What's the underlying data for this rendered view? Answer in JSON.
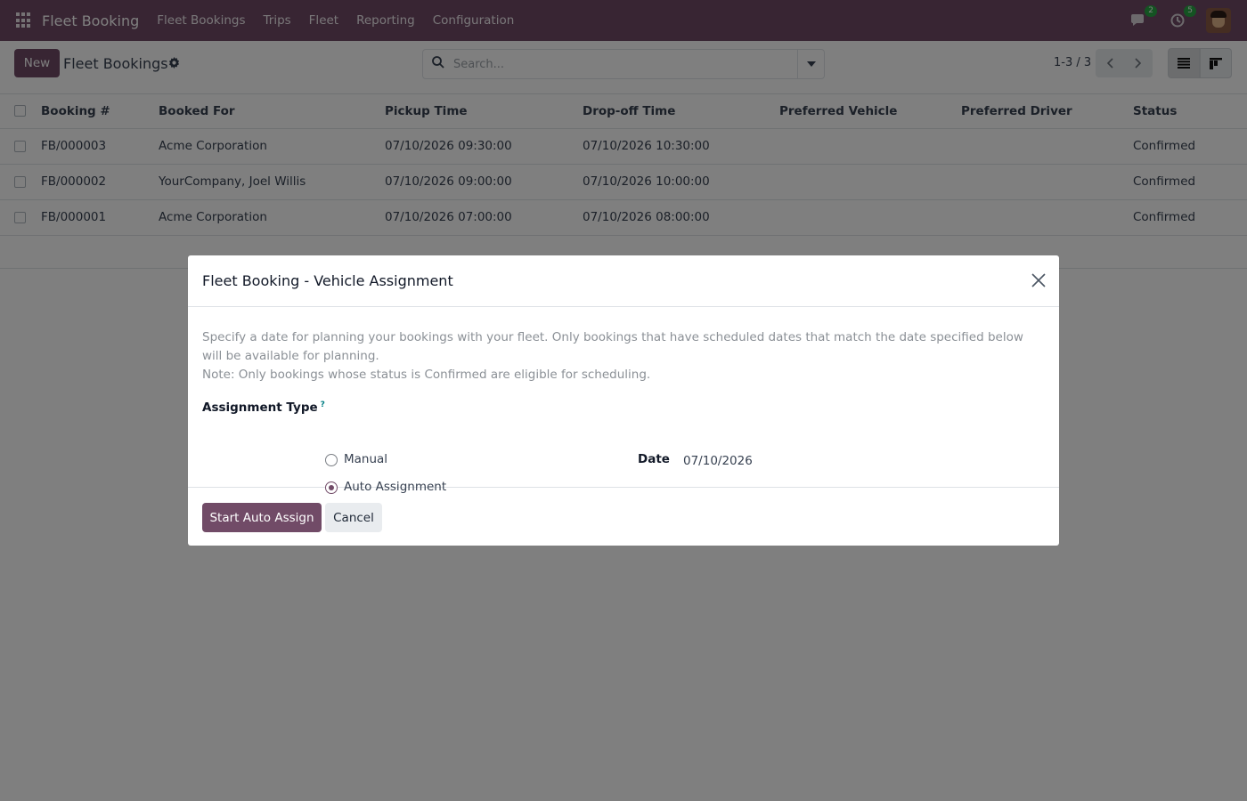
{
  "navbar": {
    "brand": "Fleet Booking",
    "menu": [
      "Fleet Bookings",
      "Trips",
      "Fleet",
      "Reporting",
      "Configuration"
    ],
    "messages_count": "2",
    "activities_count": "5",
    "accent_color": "#714B67"
  },
  "control_panel": {
    "new_label": "New",
    "title": "Fleet Bookings",
    "search_placeholder": "Search...",
    "pager": "1-3 / 3"
  },
  "table": {
    "columns": [
      "Booking #",
      "Booked For",
      "Pickup Time",
      "Drop-off Time",
      "Preferred Vehicle",
      "Preferred Driver",
      "Status"
    ],
    "rows": [
      [
        "FB/000003",
        "Acme Corporation",
        "07/10/2026 09:30:00",
        "07/10/2026 10:30:00",
        "",
        "",
        "Confirmed"
      ],
      [
        "FB/000002",
        "YourCompany, Joel Willis",
        "07/10/2026 09:00:00",
        "07/10/2026 10:00:00",
        "",
        "",
        "Confirmed"
      ],
      [
        "FB/000001",
        "Acme Corporation",
        "07/10/2026 07:00:00",
        "07/10/2026 08:00:00",
        "",
        "",
        "Confirmed"
      ]
    ]
  },
  "dialog": {
    "title": "Fleet Booking - Vehicle Assignment",
    "description_line1": "Specify a date for planning your bookings with your fleet. Only bookings that have scheduled dates that match the date specified below will be available for planning.",
    "description_line2": "Note: Only bookings whose status is Confirmed are eligible for scheduling.",
    "assignment_type_label": "Assignment Type",
    "help_mark": "?",
    "options": [
      "Manual",
      "Auto Assignment"
    ],
    "selected_option": "Auto Assignment",
    "date_label": "Date",
    "date_value": "07/10/2026",
    "primary_button": "Start Auto Assign",
    "cancel_button": "Cancel"
  }
}
